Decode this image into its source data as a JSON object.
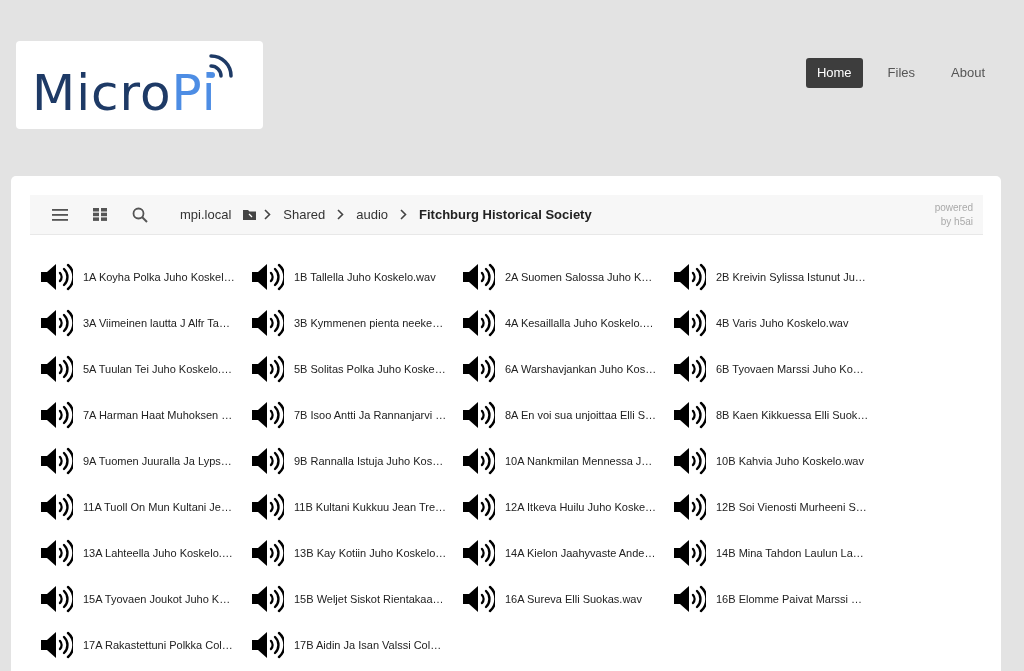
{
  "logo": {
    "text_main": "Micro",
    "text_accent": "Pi"
  },
  "nav": [
    {
      "label": "Home",
      "selected": true
    },
    {
      "label": "Files",
      "selected": false
    },
    {
      "label": "About",
      "selected": false
    }
  ],
  "breadcrumb": [
    {
      "label": "mpi.local",
      "current": false
    },
    {
      "label": "Shared",
      "current": false
    },
    {
      "label": "audio",
      "current": false
    },
    {
      "label": "Fitchburg Historical Society",
      "current": true
    }
  ],
  "powered_by": [
    "powered",
    "by h5ai"
  ],
  "files": [
    "1A Koyha Polka Juho Koskel…",
    "1B Tallella Juho Koskelo.wav",
    "2A Suomen Salossa Juho K…",
    "2B Kreivin Sylissa Istunut Ju…",
    "3A Viimeinen lautta J Alfr Ta…",
    "3B Kymmenen pienta neeke…",
    "4A Kesaillalla Juho Koskelo.…",
    "4B Varis Juho Koskelo.wav",
    "5A Tuulan Tei Juho Koskelo.…",
    "5B Solitas Polka Juho Koske…",
    "6A Warshavjankan Juho Kos…",
    "6B Tyovaen Marssi Juho Ko…",
    "7A Harman Haat Muhoksen …",
    "7B Isoo Antti Ja Rannanjarvi …",
    "8A En voi sua unjoittaa Elli S…",
    "8B Kaen Kikkuessa Elli Suok…",
    "9A Tuomen Juuralla Ja Lyps…",
    "9B Rannalla Istuja Juho Kos…",
    "10A Nankmilan Mennessa J…",
    "10B Kahvia Juho Koskelo.wav",
    "11A Tuoll On Mun Kultani Je…",
    "11B Kultani Kukkuu Jean Tre…",
    "12A Itkeva Huilu Juho Koske…",
    "12B Soi Vienosti Murheeni S…",
    "13A Lahteella Juho Koskelo.…",
    "13B Kay Kotiin Juho Koskelo…",
    "14A Kielon Jaahyvaste Ande…",
    "14B Mina Tahdon Laulun La…",
    "15A Tyovaen Joukot Juho K…",
    "15B Weljet Siskot Rientakaa…",
    "16A Sureva Elli Suokas.wav",
    "16B Elomme Paivat Marssi …",
    "17A Rakastettuni Polkka Col…",
    "17B Aidin Ja Isan Valssi Col…"
  ]
}
